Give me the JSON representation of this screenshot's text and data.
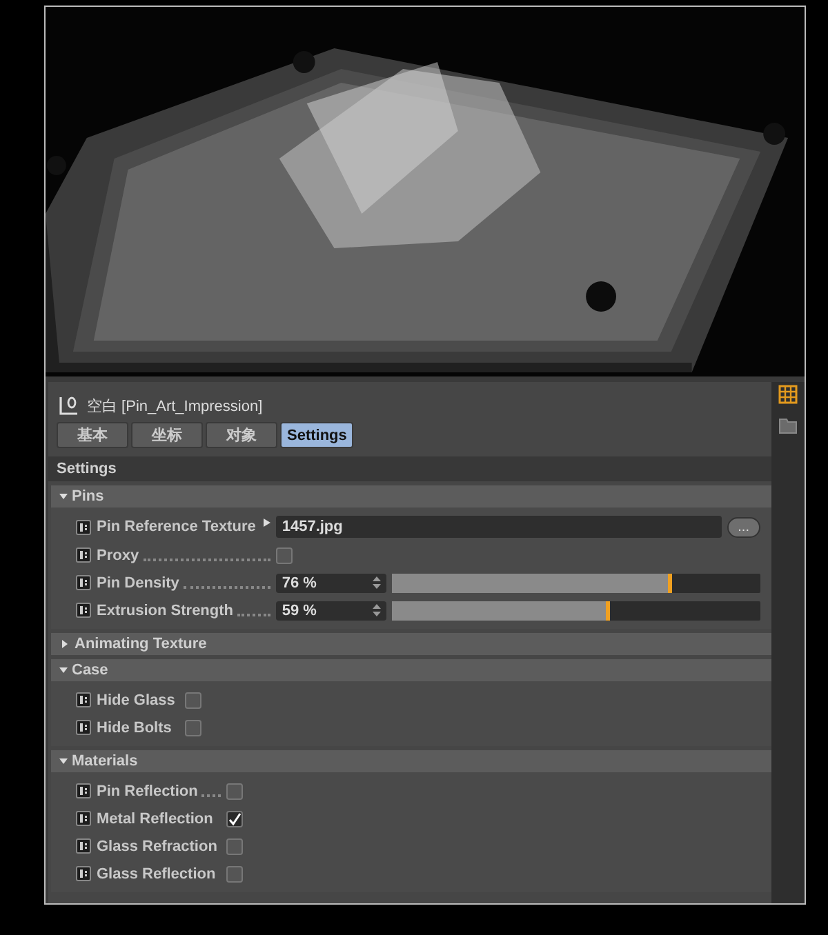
{
  "object_title": "空白 [Pin_Art_Impression]",
  "tabs": [
    {
      "label": "基本",
      "selected": false
    },
    {
      "label": "坐标",
      "selected": false
    },
    {
      "label": "对象",
      "selected": false
    },
    {
      "label": "Settings",
      "selected": true
    }
  ],
  "section_title": "Settings",
  "groups": [
    {
      "title": "Pins",
      "expanded": true,
      "rows": [
        {
          "kind": "file",
          "label": "Pin Reference Texture",
          "value": "1457.jpg",
          "button": "..."
        },
        {
          "kind": "checkbox",
          "label": "Proxy",
          "leader": true,
          "checked": false
        },
        {
          "kind": "slider",
          "label": "Pin Density",
          "leader": true,
          "value": "76 %",
          "level": 0.76
        },
        {
          "kind": "slider",
          "label": "Extrusion Strength",
          "leader": true,
          "value": "59 %",
          "level": 0.59
        }
      ]
    },
    {
      "title": "Animating Texture",
      "expanded": false
    },
    {
      "title": "Case",
      "expanded": true,
      "rows": [
        {
          "kind": "checkbox",
          "label": "Hide Glass",
          "leader": false,
          "checked": false
        },
        {
          "kind": "checkbox",
          "label": "Hide Bolts",
          "leader": false,
          "checked": false
        }
      ]
    },
    {
      "title": "Materials",
      "expanded": true,
      "rows": [
        {
          "kind": "checkbox",
          "label": "Pin Reflection",
          "leader": true,
          "checked": false
        },
        {
          "kind": "checkbox",
          "label": "Metal Reflection",
          "leader": false,
          "checked": true
        },
        {
          "kind": "checkbox",
          "label": "Glass Refraction",
          "leader": false,
          "checked": false
        },
        {
          "kind": "checkbox",
          "label": "Glass Reflection",
          "leader": false,
          "checked": false
        }
      ]
    }
  ]
}
